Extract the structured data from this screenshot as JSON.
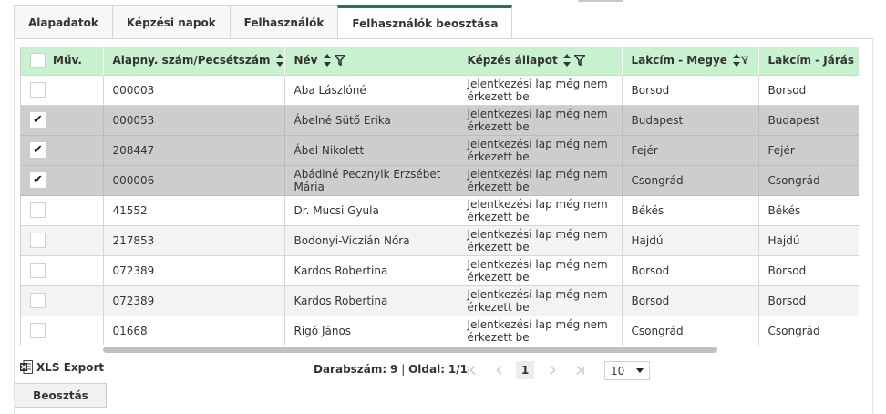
{
  "tabs": [
    {
      "label": "Alapadatok",
      "active": false
    },
    {
      "label": "Képzési napok",
      "active": false
    },
    {
      "label": "Felhasználók",
      "active": false
    },
    {
      "label": "Felhasználók beosztása",
      "active": true
    }
  ],
  "table": {
    "columns": [
      {
        "label": "Műv.",
        "sortable": false,
        "filterable": false
      },
      {
        "label": "Alapny. szám/Pecsétszám",
        "sortable": true,
        "filterable": true
      },
      {
        "label": "Név",
        "sortable": true,
        "filterable": true
      },
      {
        "label": "Képzés állapot",
        "sortable": true,
        "filterable": true
      },
      {
        "label": "Lakcím - Megye",
        "sortable": true,
        "filterable": true
      },
      {
        "label": "Lakcím - Járás",
        "sortable": true,
        "filterable": false
      }
    ],
    "rows": [
      {
        "checked": false,
        "id": "000003",
        "name": "Aba Lászlóné",
        "status": "Jelentkezési lap még nem érkezett be",
        "county": "Borsod",
        "district": "Borsod"
      },
      {
        "checked": true,
        "id": "000053",
        "name": "Ábelné Sütő Erika",
        "status": "Jelentkezési lap még nem érkezett be",
        "county": "Budapest",
        "district": "Budapest"
      },
      {
        "checked": true,
        "id": "208447",
        "name": "Ábel Nikolett",
        "status": "Jelentkezési lap még nem érkezett be",
        "county": "Fejér",
        "district": "Fejér"
      },
      {
        "checked": true,
        "id": "000006",
        "name": "Abádiné Pecznyik Erzsébet Mária",
        "status": "Jelentkezési lap még nem érkezett be",
        "county": "Csongrád",
        "district": "Csongrád"
      },
      {
        "checked": false,
        "id": "41552",
        "name": "Dr. Mucsi Gyula",
        "status": "Jelentkezési lap még nem érkezett be",
        "county": "Békés",
        "district": "Békés"
      },
      {
        "checked": false,
        "id": "217853",
        "name": "Bodonyi-Viczián Nóra",
        "status": "Jelentkezési lap még nem érkezett be",
        "county": "Hajdú",
        "district": "Hajdú"
      },
      {
        "checked": false,
        "id": "072389",
        "name": "Kardos Robertina",
        "status": "Jelentkezési lap még nem érkezett be",
        "county": "Borsod",
        "district": "Borsod"
      },
      {
        "checked": false,
        "id": "072389",
        "name": "Kardos Robertina",
        "status": "Jelentkezési lap még nem érkezett be",
        "county": "Borsod",
        "district": "Borsod"
      },
      {
        "checked": false,
        "id": "01668",
        "name": "Rigó János",
        "status": "Jelentkezési lap még nem érkezett be",
        "county": "Csongrád",
        "district": "Csongrád"
      }
    ]
  },
  "footer": {
    "export_label": "XLS Export",
    "count_label": "Darabszám:",
    "count_value": "9",
    "separator": "|",
    "page_label": "Oldal:",
    "page_value": "1/1",
    "current_page": "1",
    "page_size": "10",
    "assign_button": "Beosztás"
  },
  "colors": {
    "header_bg": "#c8f1cf",
    "selected_row_bg": "#cdcdcd",
    "active_tab_accent": "#2e6f5b"
  },
  "icons": {
    "sort": "sort-updown-icon",
    "filter": "filter-funnel-icon",
    "check": "checkmark-icon",
    "excel": "excel-file-icon"
  }
}
